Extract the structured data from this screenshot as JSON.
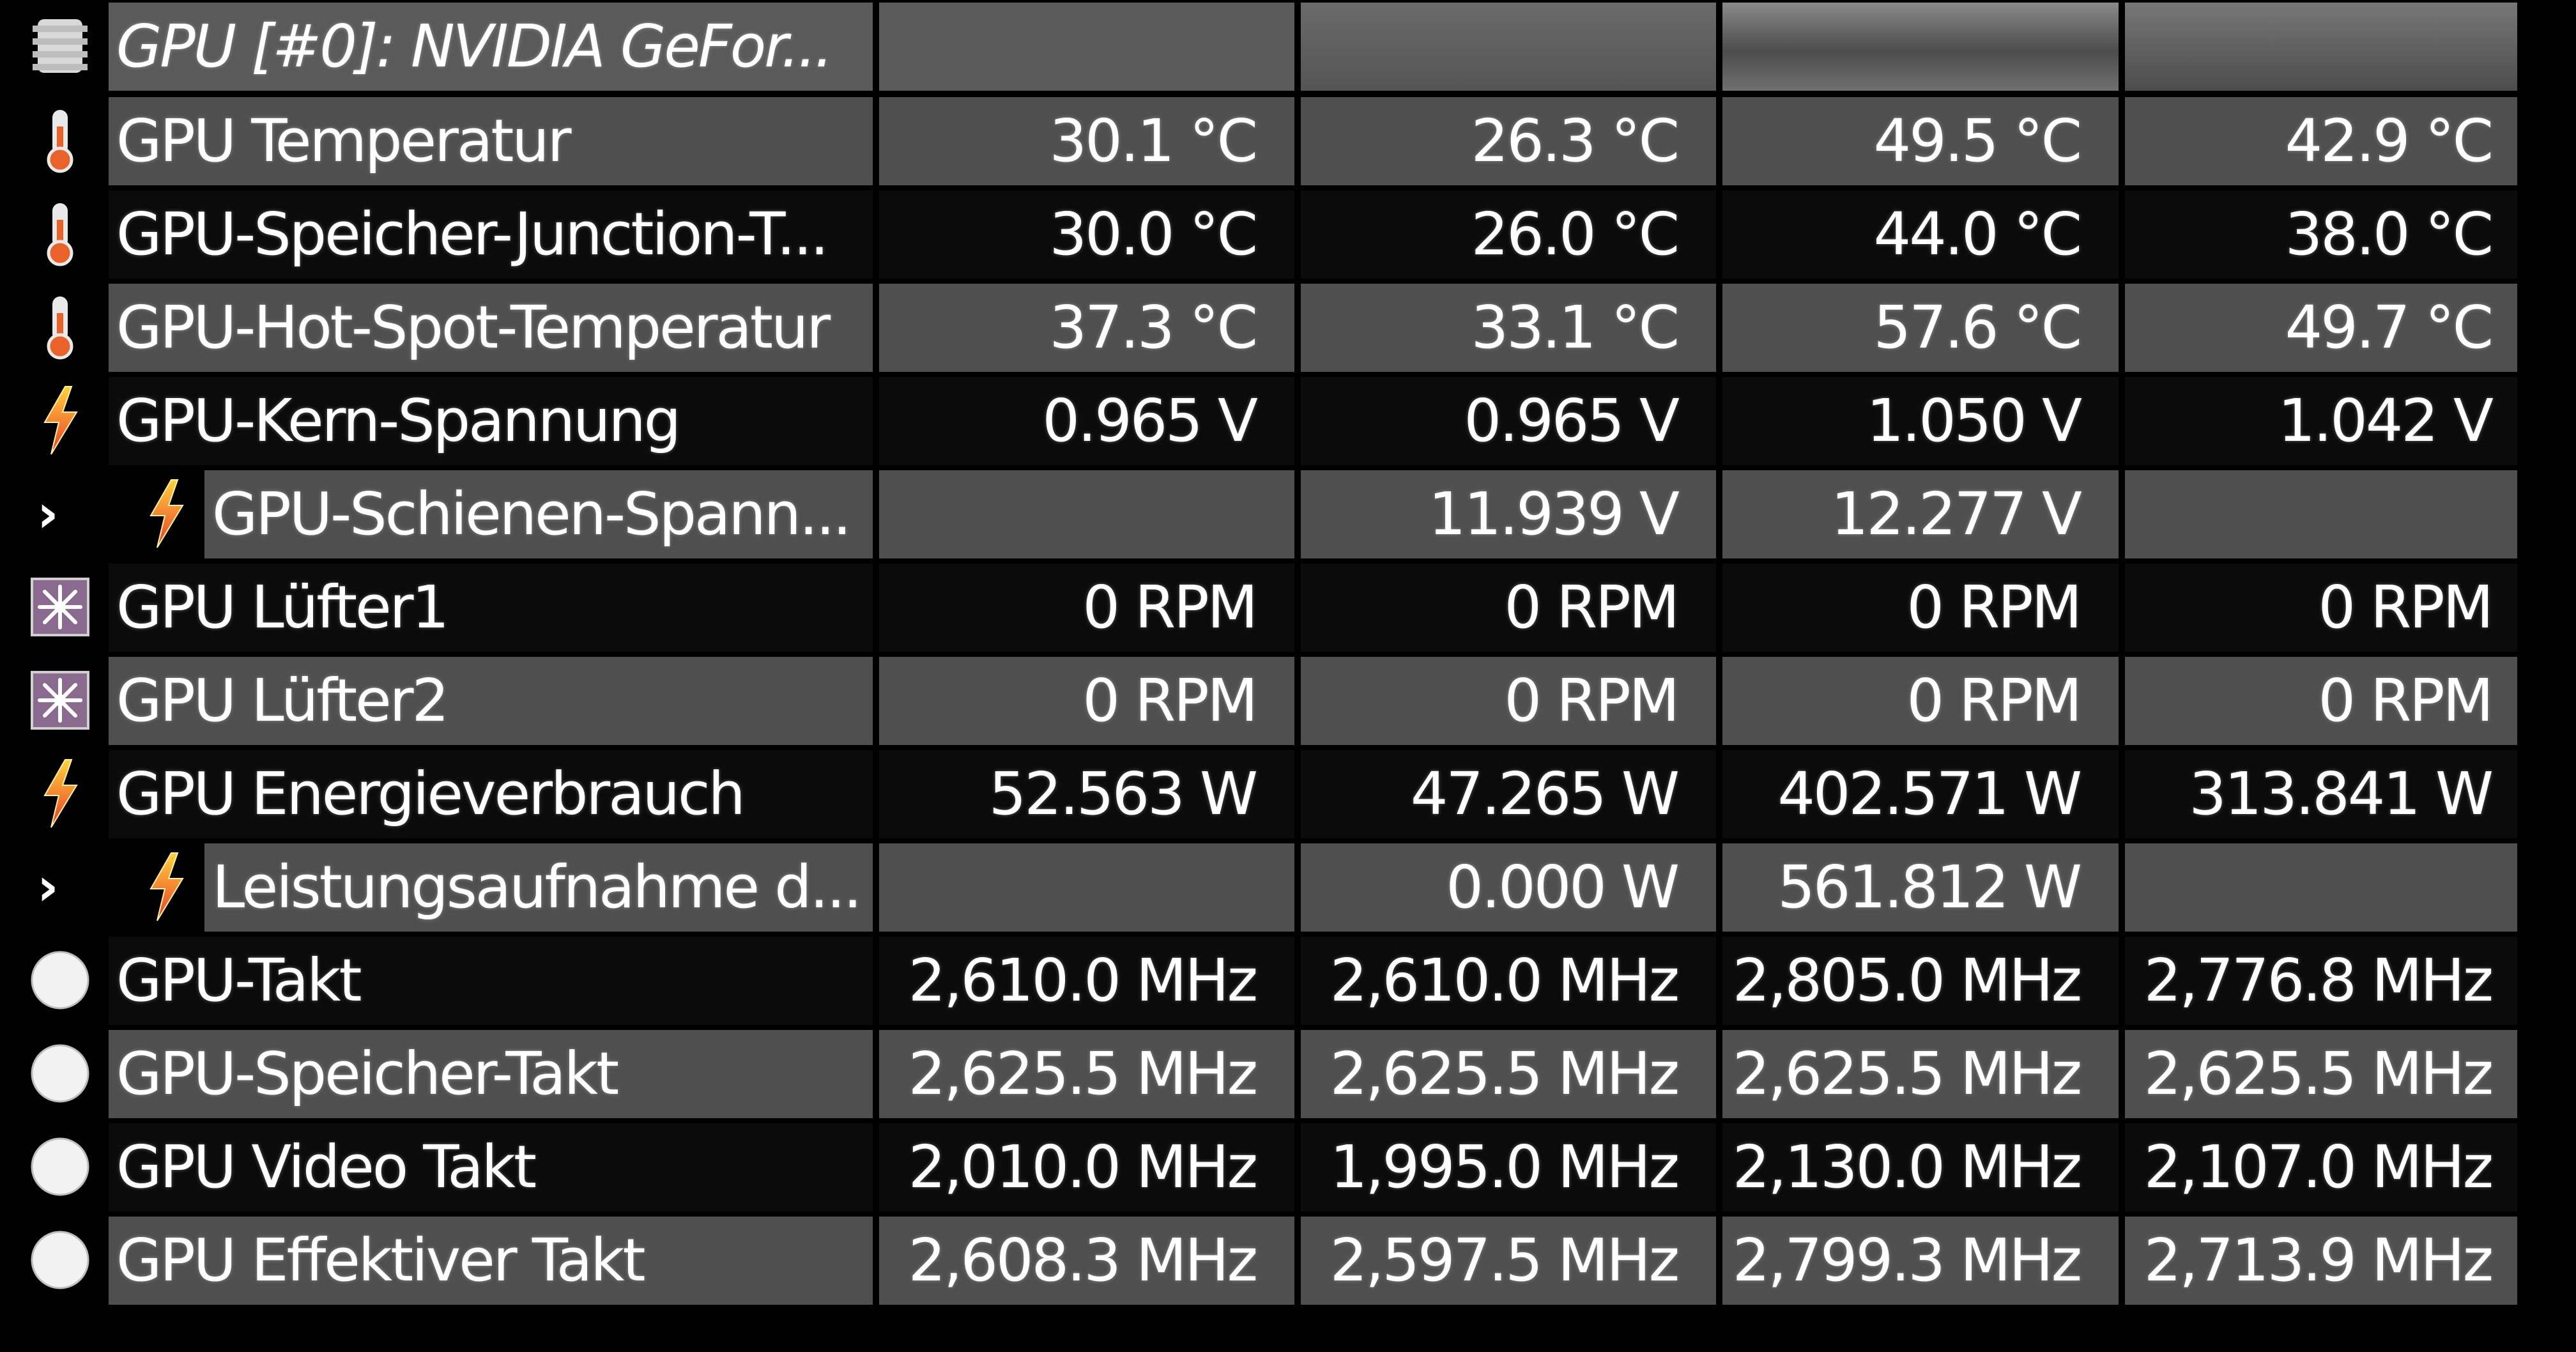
{
  "header": {
    "title": "GPU [#0]: NVIDIA GeFor..."
  },
  "rows": [
    {
      "label": "GPU Temperatur",
      "icon": "thermometer-icon",
      "values": [
        "30.1 °C",
        "26.3 °C",
        "49.5 °C",
        "42.9 °C"
      ]
    },
    {
      "label": "GPU-Speicher-Junction-T...",
      "icon": "thermometer-icon",
      "values": [
        "30.0 °C",
        "26.0 °C",
        "44.0 °C",
        "38.0 °C"
      ]
    },
    {
      "label": "GPU-Hot-Spot-Temperatur",
      "icon": "thermometer-icon",
      "values": [
        "37.3 °C",
        "33.1 °C",
        "57.6 °C",
        "49.7 °C"
      ]
    },
    {
      "label": "GPU-Kern-Spannung",
      "icon": "lightning-icon",
      "values": [
        "0.965 V",
        "0.965 V",
        "1.050 V",
        "1.042 V"
      ]
    },
    {
      "label": "GPU-Schienen-Spann...",
      "icon": "lightning-icon",
      "expander": "›",
      "values": [
        "",
        "11.939 V",
        "12.277 V",
        ""
      ]
    },
    {
      "label": "GPU Lüfter1",
      "icon": "fan-icon",
      "values": [
        "0 RPM",
        "0 RPM",
        "0 RPM",
        "0 RPM"
      ]
    },
    {
      "label": "GPU Lüfter2",
      "icon": "fan-icon",
      "values": [
        "0 RPM",
        "0 RPM",
        "0 RPM",
        "0 RPM"
      ]
    },
    {
      "label": "GPU Energieverbrauch",
      "icon": "lightning-icon",
      "values": [
        "52.563 W",
        "47.265 W",
        "402.571 W",
        "313.841 W"
      ]
    },
    {
      "label": "Leistungsaufnahme d...",
      "icon": "lightning-icon",
      "expander": "›",
      "values": [
        "",
        "0.000 W",
        "561.812 W",
        ""
      ]
    },
    {
      "label": "GPU-Takt",
      "icon": "clock-icon",
      "values": [
        "2,610.0 MHz",
        "2,610.0 MHz",
        "2,805.0 MHz",
        "2,776.8 MHz"
      ]
    },
    {
      "label": "GPU-Speicher-Takt",
      "icon": "clock-icon",
      "values": [
        "2,625.5 MHz",
        "2,625.5 MHz",
        "2,625.5 MHz",
        "2,625.5 MHz"
      ]
    },
    {
      "label": "GPU Video Takt",
      "icon": "clock-icon",
      "values": [
        "2,010.0 MHz",
        "1,995.0 MHz",
        "2,130.0 MHz",
        "2,107.0 MHz"
      ]
    },
    {
      "label": "GPU Effektiver Takt",
      "icon": "clock-icon",
      "values": [
        "2,608.3 MHz",
        "2,597.5 MHz",
        "2,799.3 MHz",
        "2,713.9 MHz"
      ]
    }
  ],
  "colors": {
    "text": "#ffffff",
    "row_dark": "#0b0b0b",
    "row_light": "#4f4f4f",
    "thermometer": "#e8622a",
    "lightning_top": "#ffd23c",
    "lightning_bottom": "#e83a2a"
  }
}
